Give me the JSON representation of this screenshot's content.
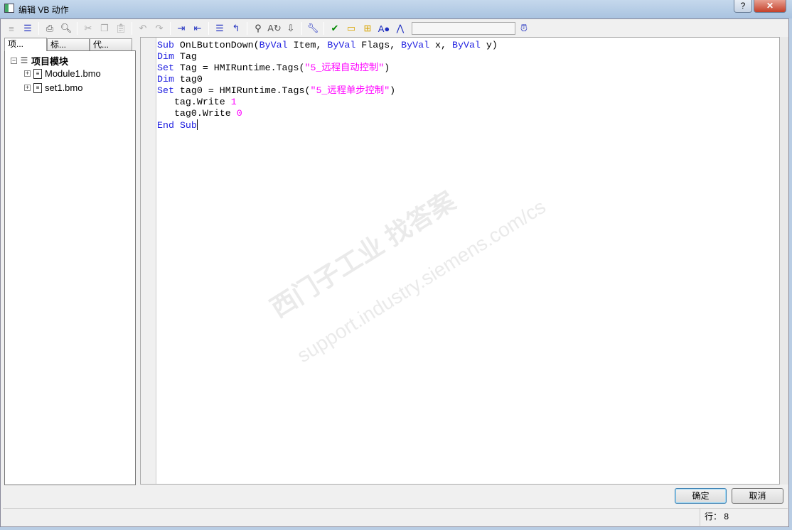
{
  "window": {
    "title": "编辑 VB 动作",
    "help": "?",
    "close": "✕"
  },
  "toolbar": {
    "icons": [
      "list-icon",
      "indent-list-icon",
      "print-icon",
      "print-preview-icon",
      "cut-icon",
      "copy-icon",
      "paste-icon",
      "undo-icon",
      "redo-icon",
      "indent-icon",
      "outdent-icon",
      "comment-icon",
      "uncomment-icon",
      "find-icon",
      "replace-icon",
      "goto-icon",
      "syntax-check-icon",
      "check-icon",
      "open-folder-icon",
      "add-folder-icon",
      "tag-icon",
      "compass-icon",
      "alarm-clock-icon"
    ],
    "search_value": ""
  },
  "left": {
    "tabs": [
      {
        "label": "项..."
      },
      {
        "label": "标..."
      },
      {
        "label": "代..."
      }
    ],
    "tree": {
      "root": "项目模块",
      "children": [
        {
          "label": "Module1.bmo"
        },
        {
          "label": "set1.bmo"
        }
      ]
    }
  },
  "code": {
    "l1": {
      "a": "Sub",
      "b": " OnLButtonDown(",
      "c": "ByVal",
      "d": " Item, ",
      "e": "ByVal",
      "f": " Flags, ",
      "g": "ByVal",
      "h": " x, ",
      "i": "ByVal",
      "j": " y)"
    },
    "l2": {
      "a": "Dim",
      "b": " Tag"
    },
    "l3": {
      "a": "Set",
      "b": " Tag = HMIRuntime.Tags(",
      "c": "\"5_远程自动控制\"",
      "d": ")"
    },
    "l4": {
      "a": "Dim",
      "b": " tag0"
    },
    "l5": {
      "a": "Set",
      "b": " tag0 = HMIRuntime.Tags(",
      "c": "\"5_远程单步控制\"",
      "d": ")"
    },
    "l6": {
      "a": "   tag.Write ",
      "b": "1"
    },
    "l7": {
      "a": "   tag0.Write ",
      "b": "0"
    },
    "l8": {
      "a": "End",
      "b": " ",
      "c": "Sub"
    }
  },
  "buttons": {
    "ok": "确定",
    "cancel": "取消"
  },
  "status": {
    "line_label": "行：",
    "line_value": "8"
  },
  "watermark": {
    "cn": "西门子工业  找答案",
    "url": "support.industry.siemens.com/cs"
  }
}
